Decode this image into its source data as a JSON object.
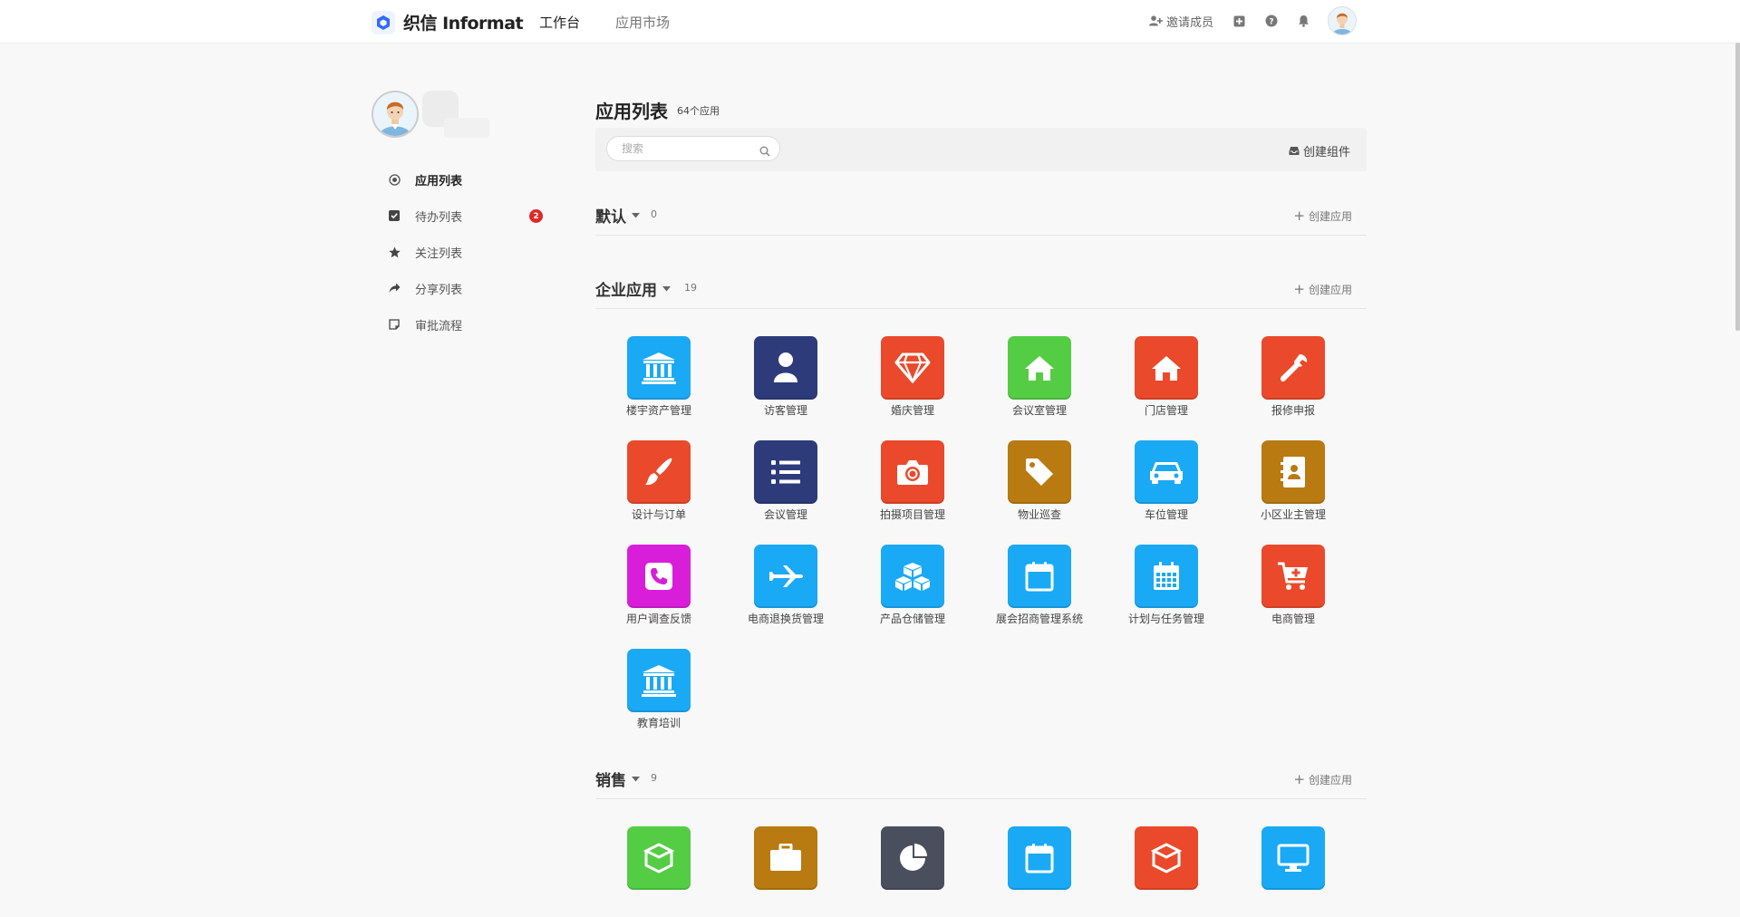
{
  "brand": {
    "name": "织信 Informat"
  },
  "nav": {
    "workbench": "工作台",
    "market": "应用市场"
  },
  "header": {
    "invite_label": "邀请成员"
  },
  "sidebar": {
    "items": [
      {
        "label": "应用列表",
        "icon": "target-icon"
      },
      {
        "label": "待办列表",
        "icon": "check-square-icon",
        "badge": "2"
      },
      {
        "label": "关注列表",
        "icon": "star-icon"
      },
      {
        "label": "分享列表",
        "icon": "share-icon"
      },
      {
        "label": "审批流程",
        "icon": "note-icon"
      }
    ]
  },
  "main": {
    "title": "应用列表",
    "count": "64个应用",
    "search_placeholder": "搜索",
    "create_widget": "创建组件"
  },
  "groups": [
    {
      "name": "默认",
      "count": "0",
      "create_label": "创建应用"
    },
    {
      "name": "企业应用",
      "count": "19",
      "create_label": "创建应用"
    },
    {
      "name": "销售",
      "count": "9",
      "create_label": "创建应用"
    }
  ],
  "apps": [
    {
      "name": "楼宇资产管理",
      "icon": "bank-icon",
      "color": "#1aa9f5"
    },
    {
      "name": "访客管理",
      "icon": "user-icon",
      "color": "#2e3b7a"
    },
    {
      "name": "婚庆管理",
      "icon": "diamond-icon",
      "color": "#ea4a2b"
    },
    {
      "name": "会议室管理",
      "icon": "home-icon",
      "color": "#54cd45"
    },
    {
      "name": "门店管理",
      "icon": "home-icon",
      "color": "#ea4a2b"
    },
    {
      "name": "报修申报",
      "icon": "wrench-icon",
      "color": "#ea4a2b"
    },
    {
      "name": "设计与订单",
      "icon": "brush-icon",
      "color": "#ea4a2b"
    },
    {
      "name": "会议管理",
      "icon": "list-icon",
      "color": "#2e3b7a"
    },
    {
      "name": "拍摄项目管理",
      "icon": "camera-icon",
      "color": "#ea4a2b"
    },
    {
      "name": "物业巡查",
      "icon": "tag-icon",
      "color": "#b97a12"
    },
    {
      "name": "车位管理",
      "icon": "car-icon",
      "color": "#1aa9f5"
    },
    {
      "name": "小区业主管理",
      "icon": "contact-book-icon",
      "color": "#b97a12"
    },
    {
      "name": "用户调查反馈",
      "icon": "phone-icon",
      "color": "#d91ed9"
    },
    {
      "name": "电商退换货管理",
      "icon": "plane-icon",
      "color": "#1aa9f5"
    },
    {
      "name": "产品仓储管理",
      "icon": "cubes-icon",
      "color": "#1aa9f5"
    },
    {
      "name": "展会招商管理系统",
      "icon": "calendar-icon",
      "color": "#1aa9f5"
    },
    {
      "name": "计划与任务管理",
      "icon": "calendar-grid-icon",
      "color": "#1aa9f5"
    },
    {
      "name": "电商管理",
      "icon": "cart-plus-icon",
      "color": "#ea4a2b"
    },
    {
      "name": "教育培训",
      "icon": "bank-icon",
      "color": "#1aa9f5"
    }
  ],
  "sales_apps": [
    {
      "icon": "cube-icon",
      "color": "#54cd45"
    },
    {
      "icon": "briefcase-icon",
      "color": "#b97a12"
    },
    {
      "icon": "pie-chart-icon",
      "color": "#4a4f5e"
    },
    {
      "icon": "calendar-icon",
      "color": "#1aa9f5"
    },
    {
      "icon": "cube-icon",
      "color": "#ea4a2b"
    },
    {
      "icon": "desktop-icon",
      "color": "#1aa9f5"
    }
  ]
}
